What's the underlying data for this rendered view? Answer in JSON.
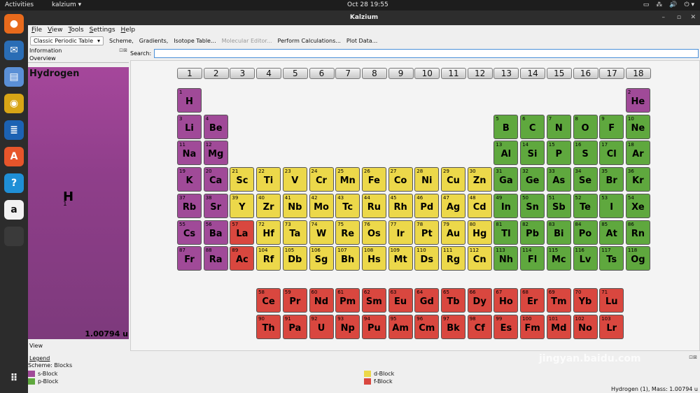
{
  "system": {
    "activities": "Activities",
    "app_menu": "kalzium ▾",
    "clock": "Oct 28  19:55",
    "tray": [
      "▭",
      "⁂",
      "🔊",
      "⏻ ▾"
    ]
  },
  "dock": [
    {
      "name": "firefox-icon",
      "color": "#e86a1c",
      "glyph": "●"
    },
    {
      "name": "thunderbird-icon",
      "color": "#2a6db5",
      "glyph": "✉"
    },
    {
      "name": "files-icon",
      "color": "#5a8fd6",
      "glyph": "▤"
    },
    {
      "name": "rhythmbox-icon",
      "color": "#d8a516",
      "glyph": "◉"
    },
    {
      "name": "writer-icon",
      "color": "#1c62b3",
      "glyph": "≣"
    },
    {
      "name": "software-icon",
      "color": "#e7552b",
      "glyph": "A"
    },
    {
      "name": "help-icon",
      "color": "#1f8fd6",
      "glyph": "?"
    },
    {
      "name": "amazon-icon",
      "color": "#f2f2f2",
      "glyph": "a"
    },
    {
      "name": "kalzium-dock-icon",
      "color": "#3a3a3a",
      "glyph": ""
    }
  ],
  "window": {
    "title": "Kalzium",
    "minimize": "–",
    "maximize": "▫",
    "close": "✕"
  },
  "menu": [
    "File",
    "View",
    "Tools",
    "Settings",
    "Help"
  ],
  "toolbar": {
    "table": "Classic Periodic Table",
    "table_arrow": "▾",
    "items": [
      "Scheme,",
      "Gradients,",
      "Isotope Table...",
      "Molecular Editor...",
      "Perform Calculations...",
      "Plot Data..."
    ],
    "disabled_index": 3
  },
  "info": {
    "header": "Information",
    "tab": "Overview",
    "name": "Hydrogen",
    "symbol": "H",
    "number": "1",
    "mass": "1.00794 u",
    "card_color": "#9a4592"
  },
  "search": {
    "label": "Search:",
    "value": ""
  },
  "groups": [
    "1",
    "2",
    "3",
    "4",
    "5",
    "6",
    "7",
    "8",
    "9",
    "10",
    "11",
    "12",
    "13",
    "14",
    "15",
    "16",
    "17",
    "18"
  ],
  "elements": [
    [
      1,
      "H",
      "s",
      1,
      1
    ],
    [
      2,
      "He",
      "s",
      18,
      1
    ],
    [
      3,
      "Li",
      "s",
      1,
      2
    ],
    [
      4,
      "Be",
      "s",
      2,
      2
    ],
    [
      5,
      "B",
      "p",
      13,
      2
    ],
    [
      6,
      "C",
      "p",
      14,
      2
    ],
    [
      7,
      "N",
      "p",
      15,
      2
    ],
    [
      8,
      "O",
      "p",
      16,
      2
    ],
    [
      9,
      "F",
      "p",
      17,
      2
    ],
    [
      10,
      "Ne",
      "p",
      18,
      2
    ],
    [
      11,
      "Na",
      "s",
      1,
      3
    ],
    [
      12,
      "Mg",
      "s",
      2,
      3
    ],
    [
      13,
      "Al",
      "p",
      13,
      3
    ],
    [
      14,
      "Si",
      "p",
      14,
      3
    ],
    [
      15,
      "P",
      "p",
      15,
      3
    ],
    [
      16,
      "S",
      "p",
      16,
      3
    ],
    [
      17,
      "Cl",
      "p",
      17,
      3
    ],
    [
      18,
      "Ar",
      "p",
      18,
      3
    ],
    [
      19,
      "K",
      "s",
      1,
      4
    ],
    [
      20,
      "Ca",
      "s",
      2,
      4
    ],
    [
      21,
      "Sc",
      "d",
      3,
      4
    ],
    [
      22,
      "Ti",
      "d",
      4,
      4
    ],
    [
      23,
      "V",
      "d",
      5,
      4
    ],
    [
      24,
      "Cr",
      "d",
      6,
      4
    ],
    [
      25,
      "Mn",
      "d",
      7,
      4
    ],
    [
      26,
      "Fe",
      "d",
      8,
      4
    ],
    [
      27,
      "Co",
      "d",
      9,
      4
    ],
    [
      28,
      "Ni",
      "d",
      10,
      4
    ],
    [
      29,
      "Cu",
      "d",
      11,
      4
    ],
    [
      30,
      "Zn",
      "d",
      12,
      4
    ],
    [
      31,
      "Ga",
      "p",
      13,
      4
    ],
    [
      32,
      "Ge",
      "p",
      14,
      4
    ],
    [
      33,
      "As",
      "p",
      15,
      4
    ],
    [
      34,
      "Se",
      "p",
      16,
      4
    ],
    [
      35,
      "Br",
      "p",
      17,
      4
    ],
    [
      36,
      "Kr",
      "p",
      18,
      4
    ],
    [
      37,
      "Rb",
      "s",
      1,
      5
    ],
    [
      38,
      "Sr",
      "s",
      2,
      5
    ],
    [
      39,
      "Y",
      "d",
      3,
      5
    ],
    [
      40,
      "Zr",
      "d",
      4,
      5
    ],
    [
      41,
      "Nb",
      "d",
      5,
      5
    ],
    [
      42,
      "Mo",
      "d",
      6,
      5
    ],
    [
      43,
      "Tc",
      "d",
      7,
      5
    ],
    [
      44,
      "Ru",
      "d",
      8,
      5
    ],
    [
      45,
      "Rh",
      "d",
      9,
      5
    ],
    [
      46,
      "Pd",
      "d",
      10,
      5
    ],
    [
      47,
      "Ag",
      "d",
      11,
      5
    ],
    [
      48,
      "Cd",
      "d",
      12,
      5
    ],
    [
      49,
      "In",
      "p",
      13,
      5
    ],
    [
      50,
      "Sn",
      "p",
      14,
      5
    ],
    [
      51,
      "Sb",
      "p",
      15,
      5
    ],
    [
      52,
      "Te",
      "p",
      16,
      5
    ],
    [
      53,
      "I",
      "p",
      17,
      5
    ],
    [
      54,
      "Xe",
      "p",
      18,
      5
    ],
    [
      55,
      "Cs",
      "s",
      1,
      6
    ],
    [
      56,
      "Ba",
      "s",
      2,
      6
    ],
    [
      57,
      "La",
      "f",
      3,
      6
    ],
    [
      72,
      "Hf",
      "d",
      4,
      6
    ],
    [
      73,
      "Ta",
      "d",
      5,
      6
    ],
    [
      74,
      "W",
      "d",
      6,
      6
    ],
    [
      75,
      "Re",
      "d",
      7,
      6
    ],
    [
      76,
      "Os",
      "d",
      8,
      6
    ],
    [
      77,
      "Ir",
      "d",
      9,
      6
    ],
    [
      78,
      "Pt",
      "d",
      10,
      6
    ],
    [
      79,
      "Au",
      "d",
      11,
      6
    ],
    [
      80,
      "Hg",
      "d",
      12,
      6
    ],
    [
      81,
      "Tl",
      "p",
      13,
      6
    ],
    [
      82,
      "Pb",
      "p",
      14,
      6
    ],
    [
      83,
      "Bi",
      "p",
      15,
      6
    ],
    [
      84,
      "Po",
      "p",
      16,
      6
    ],
    [
      85,
      "At",
      "p",
      17,
      6
    ],
    [
      86,
      "Rn",
      "p",
      18,
      6
    ],
    [
      87,
      "Fr",
      "s",
      1,
      7
    ],
    [
      88,
      "Ra",
      "s",
      2,
      7
    ],
    [
      89,
      "Ac",
      "f",
      3,
      7
    ],
    [
      104,
      "Rf",
      "d",
      4,
      7
    ],
    [
      105,
      "Db",
      "d",
      5,
      7
    ],
    [
      106,
      "Sg",
      "d",
      6,
      7
    ],
    [
      107,
      "Bh",
      "d",
      7,
      7
    ],
    [
      108,
      "Hs",
      "d",
      8,
      7
    ],
    [
      109,
      "Mt",
      "d",
      9,
      7
    ],
    [
      110,
      "Ds",
      "d",
      10,
      7
    ],
    [
      111,
      "Rg",
      "d",
      11,
      7
    ],
    [
      112,
      "Cn",
      "d",
      12,
      7
    ],
    [
      113,
      "Nh",
      "p",
      13,
      7
    ],
    [
      114,
      "Fl",
      "p",
      14,
      7
    ],
    [
      115,
      "Mc",
      "p",
      15,
      7
    ],
    [
      116,
      "Lv",
      "p",
      16,
      7
    ],
    [
      117,
      "Ts",
      "p",
      17,
      7
    ],
    [
      118,
      "Og",
      "p",
      18,
      7
    ],
    [
      58,
      "Ce",
      "f",
      4,
      9
    ],
    [
      59,
      "Pr",
      "f",
      5,
      9
    ],
    [
      60,
      "Nd",
      "f",
      6,
      9
    ],
    [
      61,
      "Pm",
      "f",
      7,
      9
    ],
    [
      62,
      "Sm",
      "f",
      8,
      9
    ],
    [
      63,
      "Eu",
      "f",
      9,
      9
    ],
    [
      64,
      "Gd",
      "f",
      10,
      9
    ],
    [
      65,
      "Tb",
      "f",
      11,
      9
    ],
    [
      66,
      "Dy",
      "f",
      12,
      9
    ],
    [
      67,
      "Ho",
      "f",
      13,
      9
    ],
    [
      68,
      "Er",
      "f",
      14,
      9
    ],
    [
      69,
      "Tm",
      "f",
      15,
      9
    ],
    [
      70,
      "Yb",
      "f",
      16,
      9
    ],
    [
      71,
      "Lu",
      "f",
      17,
      9
    ],
    [
      90,
      "Th",
      "f",
      4,
      10
    ],
    [
      91,
      "Pa",
      "f",
      5,
      10
    ],
    [
      92,
      "U",
      "f",
      6,
      10
    ],
    [
      93,
      "Np",
      "f",
      7,
      10
    ],
    [
      94,
      "Pu",
      "f",
      8,
      10
    ],
    [
      95,
      "Am",
      "f",
      9,
      10
    ],
    [
      96,
      "Cm",
      "f",
      10,
      10
    ],
    [
      97,
      "Bk",
      "f",
      11,
      10
    ],
    [
      98,
      "Cf",
      "f",
      12,
      10
    ],
    [
      99,
      "Es",
      "f",
      13,
      10
    ],
    [
      100,
      "Fm",
      "f",
      14,
      10
    ],
    [
      101,
      "Md",
      "f",
      15,
      10
    ],
    [
      102,
      "No",
      "f",
      16,
      10
    ],
    [
      103,
      "Lr",
      "f",
      17,
      10
    ]
  ],
  "view": {
    "label": "View",
    "legend": "Legend",
    "scheme": "Scheme: Blocks"
  },
  "legend": [
    {
      "label": "s-Block",
      "color": "#a04a98"
    },
    {
      "label": "d-Block",
      "color": "#ecd84a"
    },
    {
      "label": "p-Block",
      "color": "#5fa83e"
    },
    {
      "label": "f-Block",
      "color": "#d9473f"
    }
  ],
  "status": "Hydrogen (1), Mass: 1.00794 u",
  "watermark": "jingyan.baidu.com"
}
